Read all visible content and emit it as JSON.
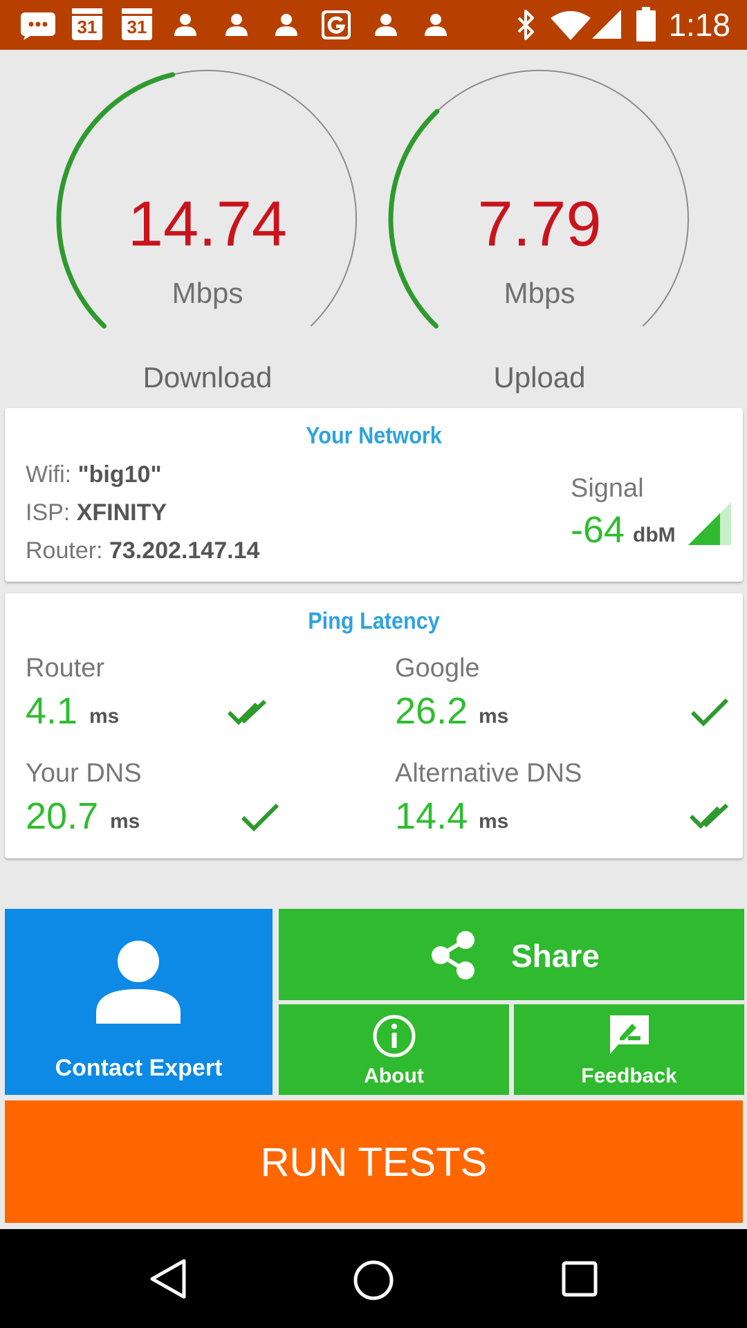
{
  "status_bar": {
    "time": "1:18",
    "left_icons": [
      "messages-icon",
      "calendar-icon",
      "calendar-icon",
      "person-icon",
      "person-icon",
      "person-icon",
      "google-g-icon",
      "person-icon",
      "person-icon"
    ],
    "calendar_day": "31",
    "right_icons": [
      "bluetooth-icon",
      "wifi-icon",
      "cell-signal-icon",
      "battery-icon"
    ]
  },
  "speed": {
    "download": {
      "value": "14.74",
      "unit": "Mbps",
      "label": "Download",
      "fill": 0.45
    },
    "upload": {
      "value": "7.79",
      "unit": "Mbps",
      "label": "Upload",
      "fill": 0.34
    }
  },
  "network": {
    "title": "Your Network",
    "wifi_label": "Wifi: ",
    "wifi_value": "\"big10\"",
    "isp_label": "ISP: ",
    "isp_value": "XFINITY",
    "router_label": "Router: ",
    "router_value": "73.202.147.14",
    "signal_label": "Signal",
    "signal_value": "-64",
    "signal_unit": "dbM"
  },
  "ping": {
    "title": "Ping Latency",
    "items": [
      {
        "label": "Router",
        "value": "4.1",
        "unit": "ms",
        "check": "double-check-icon"
      },
      {
        "label": "Google",
        "value": "26.2",
        "unit": "ms",
        "check": "check-icon"
      },
      {
        "label": "Your DNS",
        "value": "20.7",
        "unit": "ms",
        "check": "check-icon"
      },
      {
        "label": "Alternative DNS",
        "value": "14.4",
        "unit": "ms",
        "check": "double-check-icon"
      }
    ]
  },
  "actions": {
    "contact_expert": "Contact Expert",
    "share": "Share",
    "about": "About",
    "feedback": "Feedback",
    "run_tests": "RUN TESTS"
  },
  "colors": {
    "status_bar": "#b74000",
    "value_red": "#c8141c",
    "green": "#2ebd2e",
    "title_blue": "#2fa3dd",
    "contact_blue": "#0c8ae5",
    "button_green": "#2fba2f",
    "run_orange": "#ff6600"
  }
}
